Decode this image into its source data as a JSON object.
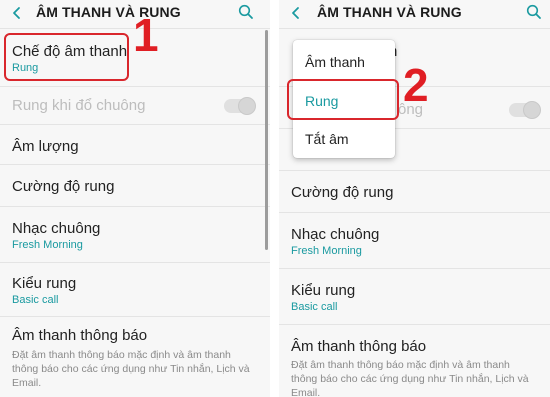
{
  "left": {
    "header": {
      "title": "ÂM THANH VÀ RUNG"
    },
    "sound_mode": {
      "title": "Chế độ âm thanh",
      "value": "Rung"
    },
    "vibrate_when_ringing": {
      "title": "Rung khi đổ chuông"
    },
    "volume": {
      "title": "Âm lượng"
    },
    "vibration_intensity": {
      "title": "Cường độ rung"
    },
    "ringtone": {
      "title": "Nhạc chuông",
      "value": "Fresh Morning"
    },
    "vibration_pattern": {
      "title": "Kiểu rung",
      "value": "Basic call"
    },
    "notification_sound": {
      "title": "Âm thanh thông báo",
      "description": "Đặt âm thanh thông báo mặc định và âm thanh thông báo cho các ứng dụng như Tin nhắn, Lịch và Email."
    },
    "step_label": "1"
  },
  "right": {
    "header": {
      "title": "ÂM THANH VÀ RUNG"
    },
    "popup": {
      "options": [
        "Âm thanh",
        "Rung",
        "Tắt âm"
      ],
      "selected": "Rung"
    },
    "partial_sound_mode_suffix": "h",
    "partial_vibrate_suffix": "ông",
    "vibration_intensity": {
      "title": "Cường độ rung"
    },
    "ringtone": {
      "title": "Nhạc chuông",
      "value": "Fresh Morning"
    },
    "vibration_pattern": {
      "title": "Kiểu rung",
      "value": "Basic call"
    },
    "notification_sound": {
      "title": "Âm thanh thông báo",
      "description": "Đặt âm thanh thông báo mặc định và âm thanh thông báo cho các ứng dụng như Tin nhắn, Lịch và Email."
    },
    "step_label": "2"
  },
  "colors": {
    "accent_teal": "#1a9aa0",
    "annotation_red": "#e01e24",
    "background": "#f7f7f7"
  },
  "icons": [
    "chevron-left-icon",
    "search-icon"
  ]
}
